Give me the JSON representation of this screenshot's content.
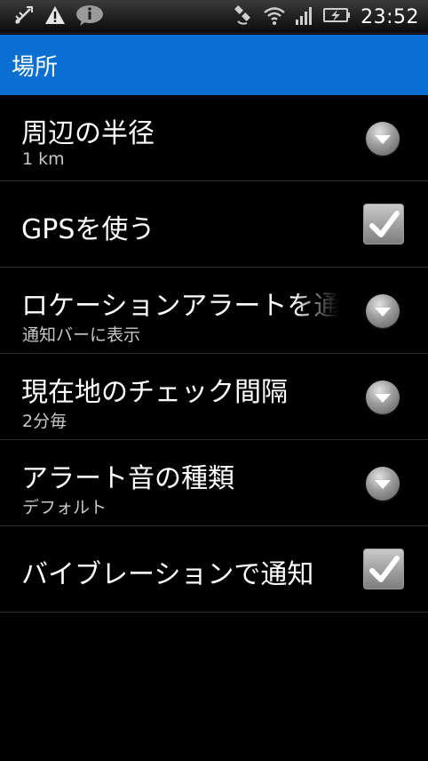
{
  "status_bar": {
    "time": "23:52",
    "left_icons": [
      "usb-debug-icon",
      "warning-icon",
      "info-icon"
    ],
    "right_icons": [
      "gps-icon",
      "wifi-icon",
      "signal-icon",
      "battery-charging-icon"
    ]
  },
  "header": {
    "title": "場所"
  },
  "settings": [
    {
      "title": "周辺の半径",
      "summary": "1 km",
      "widget": "spinner"
    },
    {
      "title": "GPSを使う",
      "widget": "checkbox",
      "checked": true
    },
    {
      "title": "ロケーションアラートを通",
      "summary": "通知バーに表示",
      "widget": "spinner"
    },
    {
      "title": "現在地のチェック間隔",
      "summary": "2分毎",
      "widget": "spinner"
    },
    {
      "title": "アラート音の種類",
      "summary": "デフォルト",
      "widget": "spinner"
    },
    {
      "title": "バイブレーションで通知",
      "widget": "checkbox",
      "checked": true
    }
  ],
  "colors": {
    "accent": "#0a6fd0",
    "background": "#000000",
    "divider": "#2e2e2e",
    "summary_text": "#c8c8c8"
  }
}
